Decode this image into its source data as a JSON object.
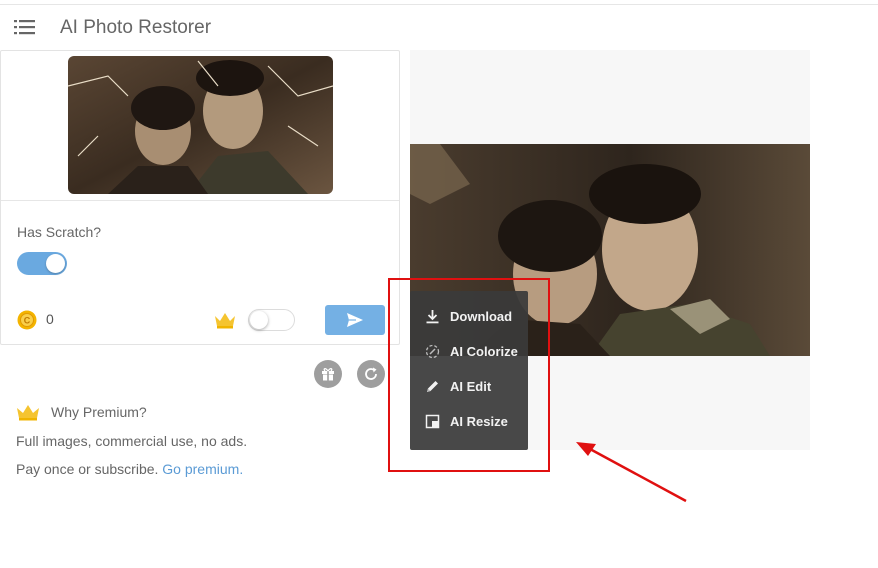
{
  "header": {
    "title": "AI Photo Restorer",
    "menu_icon": "hamburger-menu-icon"
  },
  "options": {
    "scratch_label": "Has Scratch?",
    "scratch_enabled": true,
    "coins": "0",
    "premium_enabled": false
  },
  "why": {
    "title": "Why Premium?",
    "line1": "Full images, commercial use, no ads.",
    "line2_text": "Pay once or subscribe. ",
    "line2_link": "Go premium."
  },
  "context_menu": {
    "items": [
      {
        "label": "Download",
        "icon": "download-icon"
      },
      {
        "label": "AI Colorize",
        "icon": "colorize-icon"
      },
      {
        "label": "AI Edit",
        "icon": "pencil-icon"
      },
      {
        "label": "AI Resize",
        "icon": "resize-icon"
      }
    ]
  },
  "colors": {
    "accent": "#74b0e4",
    "link": "#5b9bd5",
    "annotation": "#e01010"
  }
}
